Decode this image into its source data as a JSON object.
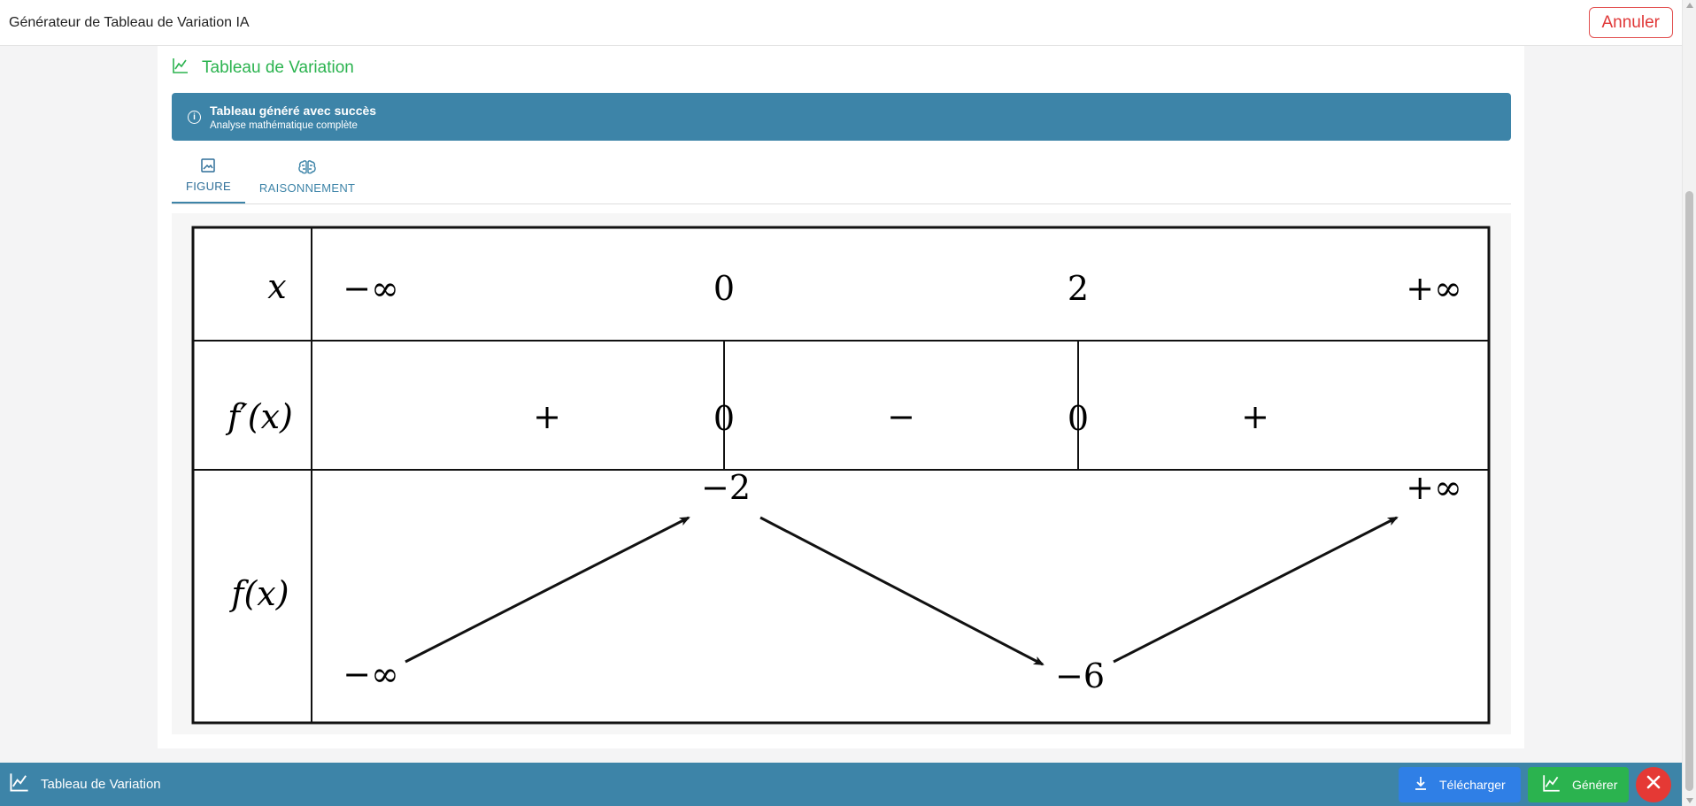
{
  "header": {
    "app_title": "Générateur de Tableau de Variation IA",
    "cancel_label": "Annuler"
  },
  "section": {
    "title": "Tableau de Variation",
    "icon": "line-chart-icon"
  },
  "alert": {
    "icon": "info-icon",
    "title": "Tableau généré avec succès",
    "subtitle": "Analyse mathématique complète"
  },
  "tabs": [
    {
      "label": "FIGURE",
      "icon": "image-icon",
      "active": true
    },
    {
      "label": "RAISONNEMENT",
      "icon": "brain-icon",
      "active": false
    }
  ],
  "variation_table": {
    "row_labels": {
      "x": "x",
      "derivative": "f′(x)",
      "function": "f(x)"
    },
    "x_values": [
      "−∞",
      "0",
      "2",
      "+∞"
    ],
    "derivative_signs": [
      "+",
      "−",
      "+"
    ],
    "derivative_zeros": [
      "0",
      "0"
    ],
    "function_values": [
      "−∞",
      "−2",
      "−6",
      "+∞"
    ]
  },
  "footer": {
    "title": "Tableau de Variation",
    "icon": "line-chart-icon",
    "download_label": "Télécharger",
    "download_icon": "download-icon",
    "generate_label": "Générer",
    "generate_icon": "line-chart-icon",
    "close_icon": "close-icon"
  },
  "colors": {
    "accent_blue": "#3d84a8",
    "success_green": "#2bb34f",
    "danger_red": "#e53935",
    "download_blue": "#2f7fe6"
  }
}
